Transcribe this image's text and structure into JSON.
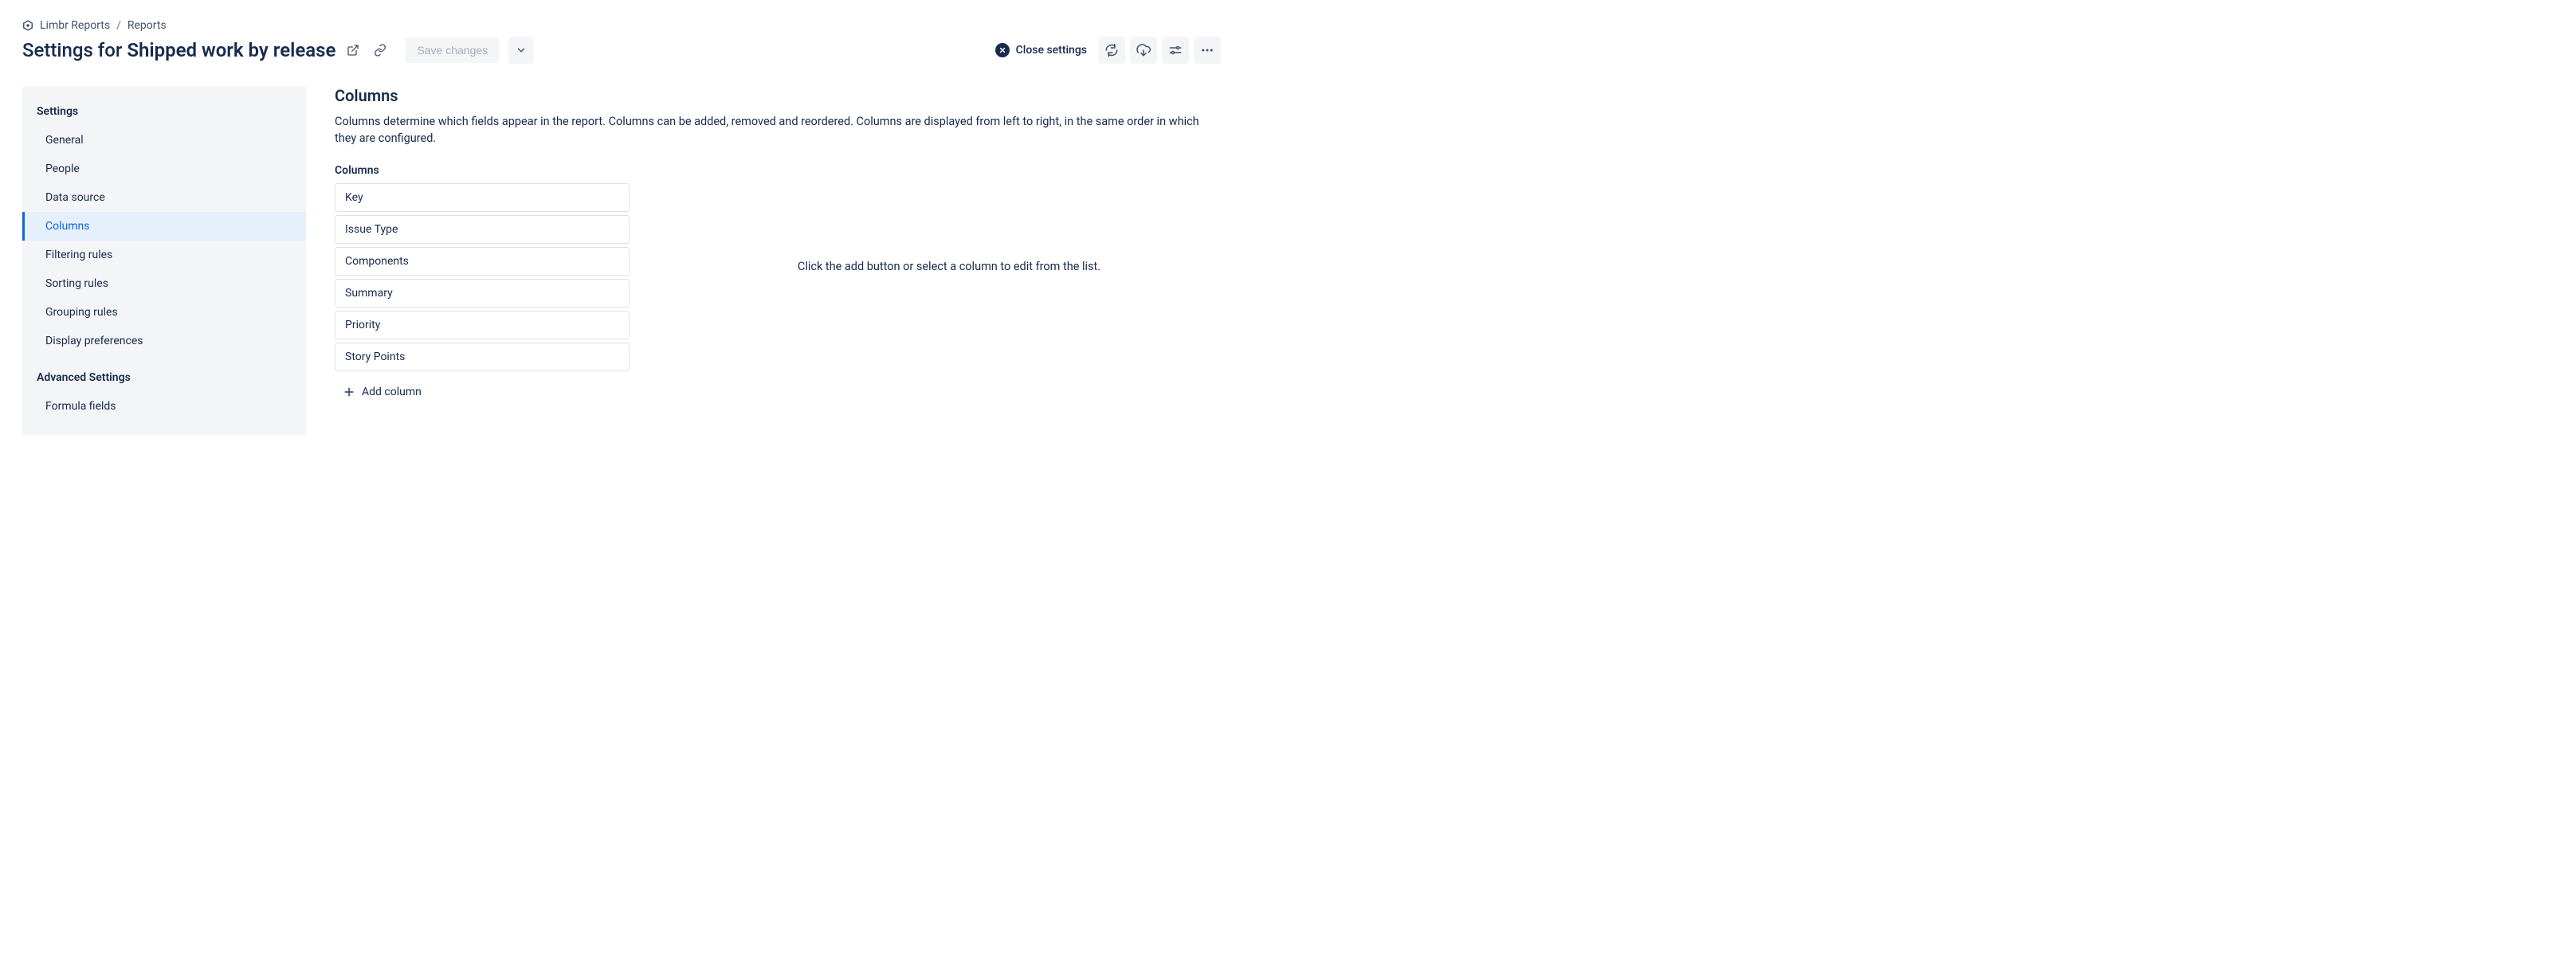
{
  "breadcrumb": {
    "app": "Limbr Reports",
    "section": "Reports"
  },
  "header": {
    "title_prefix": "Settings for ",
    "title_subject": "Shipped work by release",
    "save_label": "Save changes",
    "close_label": "Close settings"
  },
  "sidebar": {
    "heading_settings": "Settings",
    "heading_advanced": "Advanced Settings",
    "items": [
      {
        "label": "General",
        "active": false
      },
      {
        "label": "People",
        "active": false
      },
      {
        "label": "Data source",
        "active": false
      },
      {
        "label": "Columns",
        "active": true
      },
      {
        "label": "Filtering rules",
        "active": false
      },
      {
        "label": "Sorting rules",
        "active": false
      },
      {
        "label": "Grouping rules",
        "active": false
      },
      {
        "label": "Display preferences",
        "active": false
      }
    ],
    "advanced_items": [
      {
        "label": "Formula fields",
        "active": false
      }
    ]
  },
  "main": {
    "heading": "Columns",
    "description": "Columns determine which fields appear in the report. Columns can be added, removed and reordered. Columns are displayed from left to right, in the same order in which they are configured.",
    "columns_label": "Columns",
    "columns": [
      "Key",
      "Issue Type",
      "Components",
      "Summary",
      "Priority",
      "Story Points"
    ],
    "add_column_label": "Add column",
    "empty_detail_hint": "Click the add button or select a column to edit from the list."
  }
}
